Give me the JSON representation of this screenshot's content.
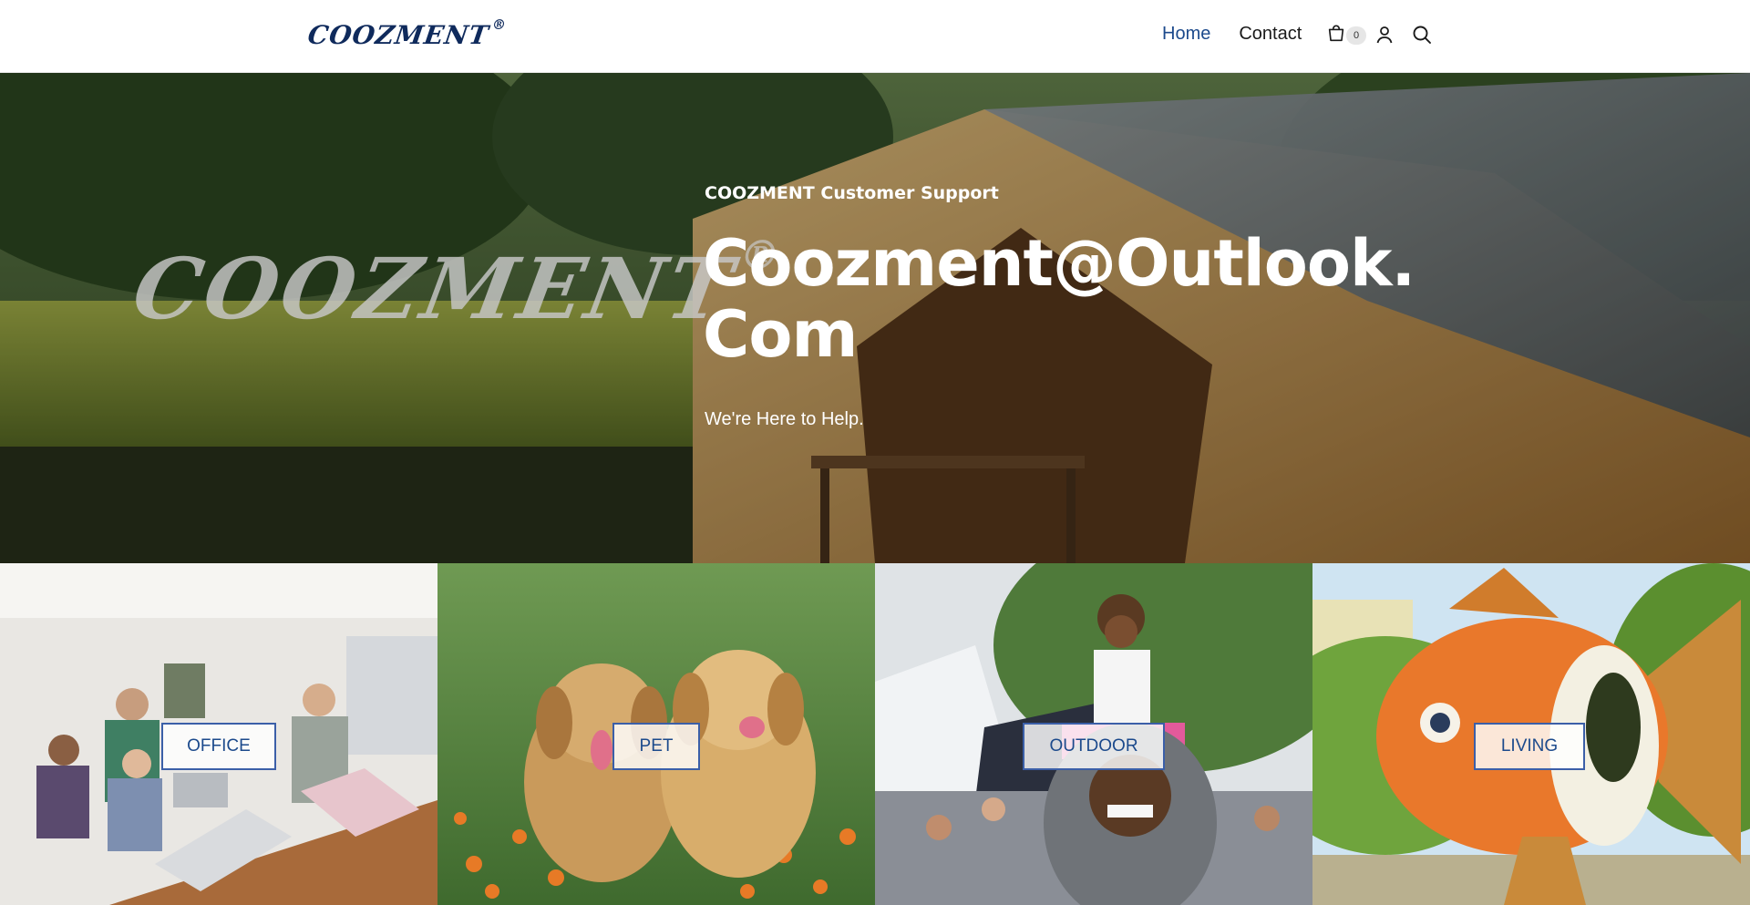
{
  "header": {
    "logo_text": "COOZMENT",
    "logo_mark": "®",
    "nav": [
      {
        "label": "Home",
        "active": true
      },
      {
        "label": "Contact",
        "active": false
      }
    ],
    "cart_icon": "cart-icon",
    "cart_count": "0",
    "account_icon": "account-icon",
    "search_icon": "search-icon",
    "accent_color": "#1c4a8c"
  },
  "hero": {
    "watermark_text": "COOZMENT",
    "watermark_mark": "®",
    "eyebrow": "COOZMENT Customer Support",
    "title_line1": "Coozment@Outlook.",
    "title_line2": "Com",
    "subtitle": "We're Here to Help."
  },
  "categories": [
    {
      "label": "OFFICE"
    },
    {
      "label": "PET"
    },
    {
      "label": "OUTDOOR"
    },
    {
      "label": "LIVING"
    }
  ]
}
